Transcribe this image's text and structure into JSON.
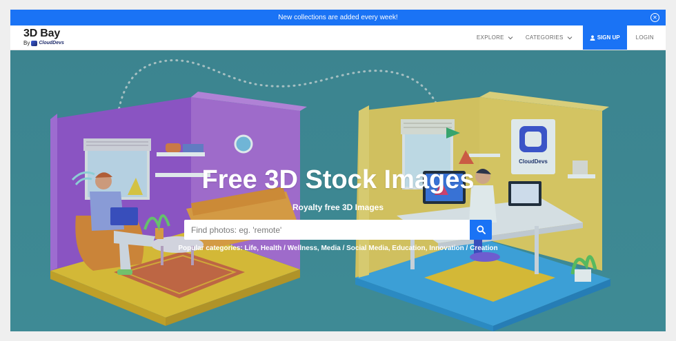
{
  "announcement": {
    "text": "New collections are added every week!",
    "close_symbol": "✕"
  },
  "brand": {
    "title": "3D Bay",
    "by_label": "By",
    "company": "CloudDevs"
  },
  "nav": {
    "explore": "EXPLORE",
    "categories": "CATEGORIES",
    "signup": "SIGN UP",
    "login": "LOGIN",
    "chevron": "⌄"
  },
  "hero": {
    "headline": "Free 3D Stock Images",
    "subheadline": "Royalty free 3D Images",
    "search_placeholder": "Find photos: eg. 'remote'",
    "search_value": "",
    "popular_label": "Popular categories:",
    "categories": [
      "Life, Health / Wellness",
      "Media / Social Media",
      "Education",
      "Innovation / Creation"
    ],
    "illustration_sign": "CloudDevs"
  },
  "colors": {
    "accent": "#1a73f5",
    "hero_bg": "#3f8c96"
  }
}
